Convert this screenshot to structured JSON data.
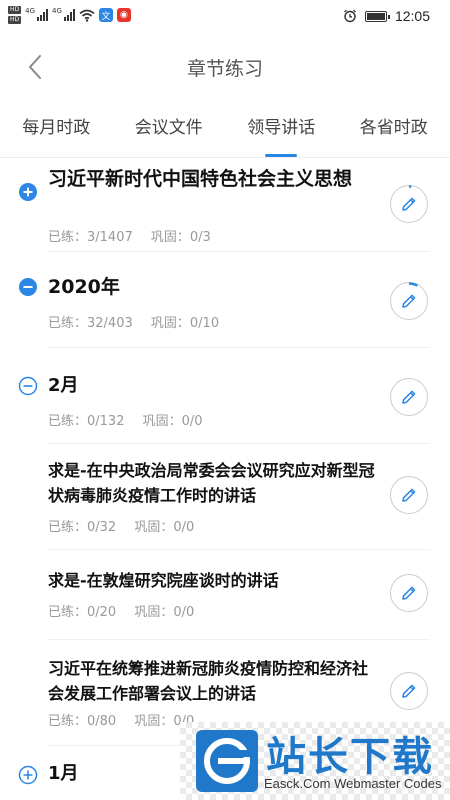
{
  "status_bar": {
    "hd_labels": [
      "HD",
      "HD"
    ],
    "network": [
      "4G",
      "4G"
    ],
    "app_badges": [
      {
        "icon": "wen-app-icon",
        "glyph": "文",
        "color": "#2b86e6"
      },
      {
        "icon": "weibo-icon",
        "glyph": "◉",
        "color": "#e6352b"
      }
    ],
    "time": "12:05",
    "battery_level": 0.9
  },
  "header": {
    "title": "章节练习",
    "back_icon": "chevron-left-icon"
  },
  "tabs": [
    {
      "label": "每月时政",
      "active": false
    },
    {
      "label": "会议文件",
      "active": false
    },
    {
      "label": "领导讲话",
      "active": true
    },
    {
      "label": "各省时政",
      "active": false
    }
  ],
  "list": [
    {
      "toggle": "plus-filled",
      "title": "习近平新时代中国特色社会主义思想",
      "done_label": "已练：3/1407",
      "consolidate_label": "巩固：0/3",
      "progress": 0.002
    },
    {
      "toggle": "minus-filled",
      "title": "2020年",
      "done_label": "已练：32/403",
      "consolidate_label": "巩固：0/10",
      "progress": 0.079
    },
    {
      "toggle": "minus-outline",
      "title": "2月",
      "done_label": "已练：0/132",
      "consolidate_label": "巩固：0/0",
      "progress": 0
    },
    {
      "toggle": "none",
      "title": "求是-在中央政治局常委会会议研究应对新型冠状病毒肺炎疫情工作时的讲话",
      "done_label": "已练：0/32",
      "consolidate_label": "巩固：0/0",
      "progress": 0
    },
    {
      "toggle": "none",
      "title": "求是-在敦煌研究院座谈时的讲话",
      "done_label": "已练：0/20",
      "consolidate_label": "巩固：0/0",
      "progress": 0
    },
    {
      "toggle": "none",
      "title": "习近平在统筹推进新冠肺炎疫情防控和经济社会发展工作部署会议上的讲话",
      "done_label": "已练：0/80",
      "consolidate_label": "巩固：0/0",
      "progress": 0
    },
    {
      "toggle": "plus-outline",
      "title": "1月",
      "done_label": "",
      "consolidate_label": "",
      "progress": 0
    }
  ],
  "watermark": {
    "title": "站长下载",
    "subtitle": "Easck.Com Webmaster Codes"
  },
  "colors": {
    "accent": "#2b86e6",
    "text_primary": "#111111",
    "text_secondary": "#999999"
  }
}
